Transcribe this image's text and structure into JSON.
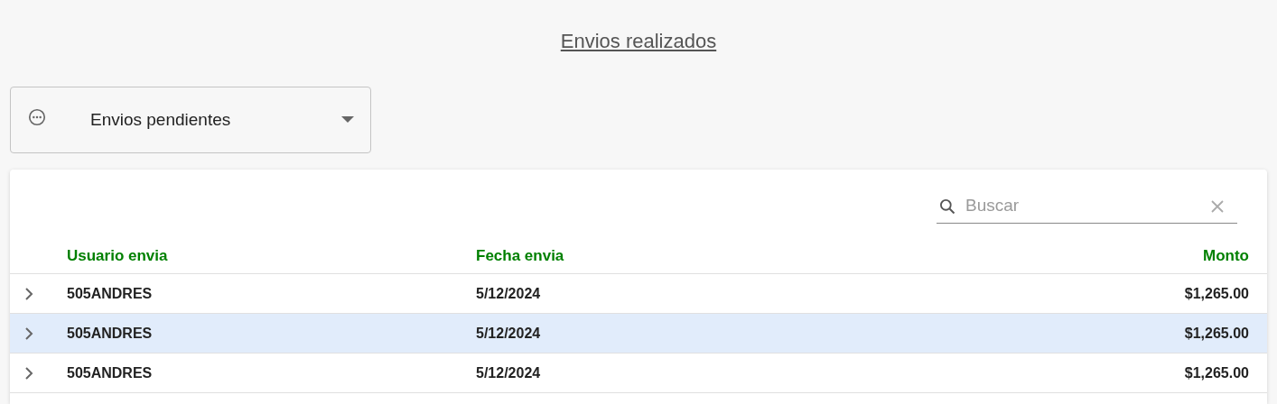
{
  "title": "Envios realizados",
  "filter": {
    "value": "Envios pendientes"
  },
  "search": {
    "placeholder": "Buscar"
  },
  "table": {
    "columns": [
      "Usuario envia",
      "Fecha envia",
      "Monto"
    ],
    "rows": [
      {
        "user": "505ANDRES",
        "date": "5/12/2024",
        "amount": "$1,265.00"
      },
      {
        "user": "505ANDRES",
        "date": "5/12/2024",
        "amount": "$1,265.00"
      },
      {
        "user": "505ANDRES",
        "date": "5/12/2024",
        "amount": "$1,265.00"
      }
    ]
  }
}
